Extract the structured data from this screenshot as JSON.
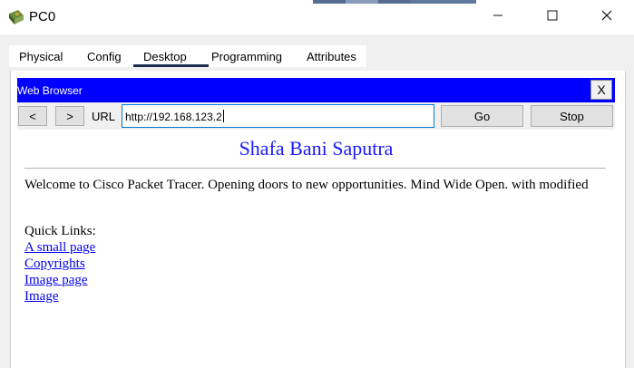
{
  "window": {
    "title": "PC0",
    "app_icon": "packet-tracer-pc-icon",
    "controls": {
      "minimize_icon": "minimize-icon",
      "maximize_icon": "maximize-icon",
      "close_icon": "close-icon"
    }
  },
  "tabs": [
    {
      "label": "Physical",
      "active": false
    },
    {
      "label": "Config",
      "active": false
    },
    {
      "label": "Desktop",
      "active": true
    },
    {
      "label": "Programming",
      "active": false
    },
    {
      "label": "Attributes",
      "active": false
    }
  ],
  "browser": {
    "title": "Web Browser",
    "close_label": "X",
    "back_label": "<",
    "forward_label": ">",
    "url_label": "URL",
    "url_value": "http://192.168.123.2",
    "go_label": "Go",
    "stop_label": "Stop",
    "header_color": "#0000ff"
  },
  "page": {
    "heading": "Shafa Bani Saputra",
    "welcome_text": "Welcome to Cisco Packet Tracer. Opening doors to new opportunities. Mind Wide Open. with modified",
    "quick_links_label": "Quick Links:",
    "links": [
      {
        "label": "A small page"
      },
      {
        "label": "Copyrights"
      },
      {
        "label": "Image page"
      },
      {
        "label": "Image"
      }
    ],
    "heading_color": "#1a1aff",
    "link_color": "#0000ee"
  }
}
